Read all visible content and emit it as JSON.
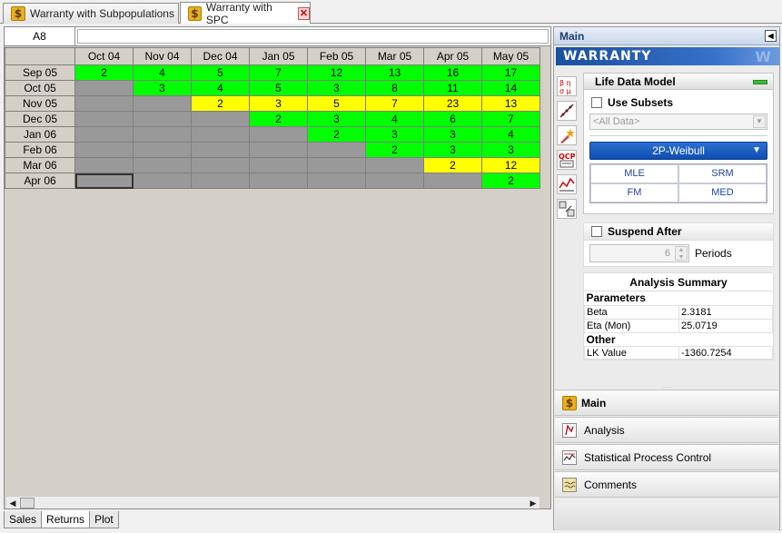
{
  "doc_tabs": [
    {
      "label": "Warranty with Subpopulations"
    },
    {
      "label": "Warranty with SPC"
    }
  ],
  "sheet": {
    "cell_ref": "A8",
    "formula_value": "",
    "columns": [
      "Oct 04",
      "Nov 04",
      "Dec 04",
      "Jan 05",
      "Feb 05",
      "Mar 05",
      "Apr 05",
      "May 05"
    ],
    "rows": [
      {
        "label": "Sep 05",
        "cells": [
          {
            "v": "2",
            "c": "g"
          },
          {
            "v": "4",
            "c": "g"
          },
          {
            "v": "5",
            "c": "g"
          },
          {
            "v": "7",
            "c": "g"
          },
          {
            "v": "12",
            "c": "g"
          },
          {
            "v": "13",
            "c": "g"
          },
          {
            "v": "16",
            "c": "g"
          },
          {
            "v": "17",
            "c": "g"
          }
        ]
      },
      {
        "label": "Oct 05",
        "cells": [
          {
            "v": "",
            "c": "x"
          },
          {
            "v": "3",
            "c": "g"
          },
          {
            "v": "4",
            "c": "g"
          },
          {
            "v": "5",
            "c": "g"
          },
          {
            "v": "3",
            "c": "g"
          },
          {
            "v": "8",
            "c": "g"
          },
          {
            "v": "11",
            "c": "g"
          },
          {
            "v": "14",
            "c": "g"
          }
        ]
      },
      {
        "label": "Nov 05",
        "cells": [
          {
            "v": "",
            "c": "x"
          },
          {
            "v": "",
            "c": "x"
          },
          {
            "v": "2",
            "c": "y"
          },
          {
            "v": "3",
            "c": "y"
          },
          {
            "v": "5",
            "c": "y"
          },
          {
            "v": "7",
            "c": "y"
          },
          {
            "v": "23",
            "c": "y"
          },
          {
            "v": "13",
            "c": "y"
          }
        ]
      },
      {
        "label": "Dec 05",
        "cells": [
          {
            "v": "",
            "c": "x"
          },
          {
            "v": "",
            "c": "x"
          },
          {
            "v": "",
            "c": "x"
          },
          {
            "v": "2",
            "c": "g"
          },
          {
            "v": "3",
            "c": "g"
          },
          {
            "v": "4",
            "c": "g"
          },
          {
            "v": "6",
            "c": "g"
          },
          {
            "v": "7",
            "c": "g"
          }
        ]
      },
      {
        "label": "Jan 06",
        "cells": [
          {
            "v": "",
            "c": "x"
          },
          {
            "v": "",
            "c": "x"
          },
          {
            "v": "",
            "c": "x"
          },
          {
            "v": "",
            "c": "x"
          },
          {
            "v": "2",
            "c": "g"
          },
          {
            "v": "3",
            "c": "g"
          },
          {
            "v": "3",
            "c": "g"
          },
          {
            "v": "4",
            "c": "g"
          }
        ]
      },
      {
        "label": "Feb 06",
        "cells": [
          {
            "v": "",
            "c": "x"
          },
          {
            "v": "",
            "c": "x"
          },
          {
            "v": "",
            "c": "x"
          },
          {
            "v": "",
            "c": "x"
          },
          {
            "v": "",
            "c": "x"
          },
          {
            "v": "2",
            "c": "g"
          },
          {
            "v": "3",
            "c": "g"
          },
          {
            "v": "3",
            "c": "g"
          }
        ]
      },
      {
        "label": "Mar 06",
        "cells": [
          {
            "v": "",
            "c": "x"
          },
          {
            "v": "",
            "c": "x"
          },
          {
            "v": "",
            "c": "x"
          },
          {
            "v": "",
            "c": "x"
          },
          {
            "v": "",
            "c": "x"
          },
          {
            "v": "",
            "c": "x"
          },
          {
            "v": "2",
            "c": "y"
          },
          {
            "v": "12",
            "c": "y"
          }
        ]
      },
      {
        "label": "Apr 06",
        "cells": [
          {
            "v": "",
            "c": "x",
            "sel": true
          },
          {
            "v": "",
            "c": "x"
          },
          {
            "v": "",
            "c": "x"
          },
          {
            "v": "",
            "c": "x"
          },
          {
            "v": "",
            "c": "x"
          },
          {
            "v": "",
            "c": "x"
          },
          {
            "v": "",
            "c": "x"
          },
          {
            "v": "2",
            "c": "g"
          }
        ]
      }
    ],
    "colors": {
      "g": "#00ff00",
      "y": "#ffff00",
      "x": "#999999"
    }
  },
  "sheet_tabs": [
    "Sales",
    "Returns",
    "Plot"
  ],
  "panel": {
    "header": "Main",
    "banner": "WARRANTY",
    "life_data_model": {
      "title": "Life Data Model",
      "use_subsets_label": "Use Subsets",
      "subset_placeholder": "<All Data>",
      "distribution": "2P-Weibull",
      "methods": [
        "MLE",
        "SRM",
        "FM",
        "MED"
      ]
    },
    "suspend": {
      "label": "Suspend After",
      "value": "6",
      "unit": "Periods"
    },
    "summary": {
      "title": "Analysis Summary",
      "parameters_heading": "Parameters",
      "params": [
        {
          "name": "Beta",
          "value": "2.3181"
        },
        {
          "name": "Eta (Mon)",
          "value": "25.0719"
        }
      ],
      "other_heading": "Other",
      "other": [
        {
          "name": "LK Value",
          "value": "-1360.7254"
        }
      ]
    },
    "nav": [
      {
        "label": "Main",
        "icon": "dollar-icon"
      },
      {
        "label": "Analysis",
        "icon": "analysis-icon"
      },
      {
        "label": "Statistical Process Control",
        "icon": "spc-chart-icon"
      },
      {
        "label": "Comments",
        "icon": "comments-icon"
      }
    ]
  }
}
